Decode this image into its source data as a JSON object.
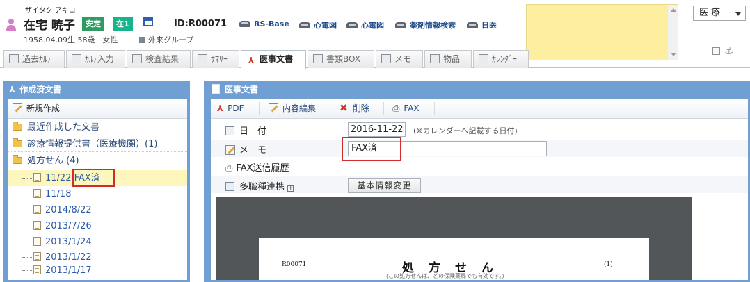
{
  "patient": {
    "kana": "ザイタク アキコ",
    "name": "在宅 暁子",
    "badge_status": "安定",
    "badge_home": "在1",
    "id_label": "ID:R00071",
    "birth_info": "1958.04.09生 58歳　女性",
    "group": "外来グループ"
  },
  "header_links": [
    "RS-Base",
    "心電図",
    "心電図",
    "薬剤情報検索",
    "日医"
  ],
  "department_select": "医療",
  "tabs": [
    {
      "label": "過去ｶﾙﾃ",
      "icon": "chart-icon"
    },
    {
      "label": "ｶﾙﾃ入力",
      "icon": "edit-icon"
    },
    {
      "label": "検査結果",
      "icon": "bar-chart-icon"
    },
    {
      "label": "ｻﾏﾘｰ",
      "icon": "summary-icon"
    },
    {
      "label": "医事文書",
      "icon": "pdf-icon"
    },
    {
      "label": "書類BOX",
      "icon": "box-icon"
    },
    {
      "label": "メモ",
      "icon": "memo-icon"
    },
    {
      "label": "物品",
      "icon": "goods-icon"
    },
    {
      "label": "ｶﾚﾝﾀﾞｰ",
      "icon": "calendar-icon"
    }
  ],
  "left_panel": {
    "title": "作成済文書",
    "new_button": "新規作成",
    "folders": [
      "最近作成した文書",
      "診療情報提供書（医療機関）(1)",
      "処方せん (4)"
    ],
    "documents": [
      "11/22 FAX済",
      "11/18",
      "2014/8/22",
      "2013/7/26",
      "2013/1/24",
      "2013/1/22",
      "2013/1/17"
    ]
  },
  "right_panel": {
    "title": "医事文書",
    "toolbar": {
      "pdf": "PDF",
      "edit": "内容編集",
      "delete": "削除",
      "fax": "FAX"
    },
    "date_label": "日　付",
    "date_value": "2016-11-22",
    "date_note": "(※カレンダーへ記載する日付)",
    "memo_label": "メ　モ",
    "memo_value": "FAX済",
    "fax_history": "FAX送信履歴",
    "multi_link": "多職種連携",
    "base_info_button": "基本情報変更"
  },
  "document_preview": {
    "patient_id": "R00071",
    "title": "処方せん",
    "page_number": "(1)",
    "subtitle": "(この処方せんは、どの保険薬局でも有効です。)"
  },
  "colors": {
    "panel_blue": "#6f9fd3",
    "highlight_red": "#d22b2b",
    "selected_row": "#fdf6bd",
    "memo_yellow": "#fdeea0",
    "badge_green": "#2e9b62",
    "badge_teal": "#18b38a"
  }
}
